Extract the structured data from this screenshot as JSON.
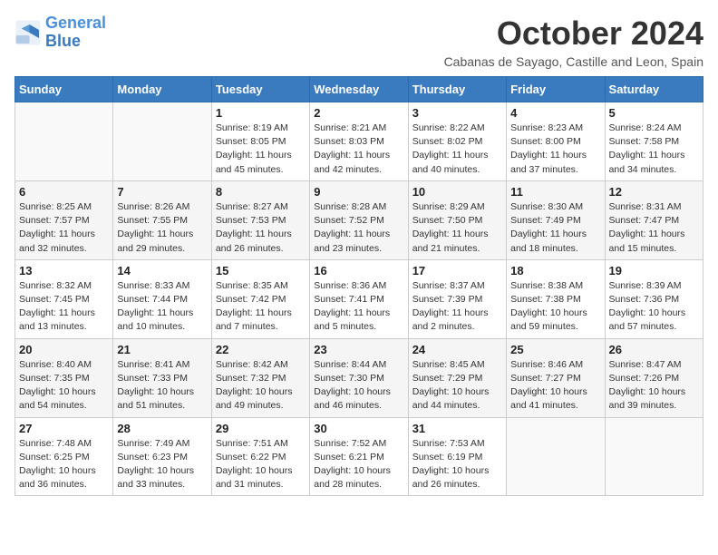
{
  "logo": {
    "line1": "General",
    "line2": "Blue"
  },
  "title": "October 2024",
  "subtitle": "Cabanas de Sayago, Castille and Leon, Spain",
  "days_of_week": [
    "Sunday",
    "Monday",
    "Tuesday",
    "Wednesday",
    "Thursday",
    "Friday",
    "Saturday"
  ],
  "weeks": [
    [
      {
        "num": "",
        "info": ""
      },
      {
        "num": "",
        "info": ""
      },
      {
        "num": "1",
        "info": "Sunrise: 8:19 AM\nSunset: 8:05 PM\nDaylight: 11 hours and 45 minutes."
      },
      {
        "num": "2",
        "info": "Sunrise: 8:21 AM\nSunset: 8:03 PM\nDaylight: 11 hours and 42 minutes."
      },
      {
        "num": "3",
        "info": "Sunrise: 8:22 AM\nSunset: 8:02 PM\nDaylight: 11 hours and 40 minutes."
      },
      {
        "num": "4",
        "info": "Sunrise: 8:23 AM\nSunset: 8:00 PM\nDaylight: 11 hours and 37 minutes."
      },
      {
        "num": "5",
        "info": "Sunrise: 8:24 AM\nSunset: 7:58 PM\nDaylight: 11 hours and 34 minutes."
      }
    ],
    [
      {
        "num": "6",
        "info": "Sunrise: 8:25 AM\nSunset: 7:57 PM\nDaylight: 11 hours and 32 minutes."
      },
      {
        "num": "7",
        "info": "Sunrise: 8:26 AM\nSunset: 7:55 PM\nDaylight: 11 hours and 29 minutes."
      },
      {
        "num": "8",
        "info": "Sunrise: 8:27 AM\nSunset: 7:53 PM\nDaylight: 11 hours and 26 minutes."
      },
      {
        "num": "9",
        "info": "Sunrise: 8:28 AM\nSunset: 7:52 PM\nDaylight: 11 hours and 23 minutes."
      },
      {
        "num": "10",
        "info": "Sunrise: 8:29 AM\nSunset: 7:50 PM\nDaylight: 11 hours and 21 minutes."
      },
      {
        "num": "11",
        "info": "Sunrise: 8:30 AM\nSunset: 7:49 PM\nDaylight: 11 hours and 18 minutes."
      },
      {
        "num": "12",
        "info": "Sunrise: 8:31 AM\nSunset: 7:47 PM\nDaylight: 11 hours and 15 minutes."
      }
    ],
    [
      {
        "num": "13",
        "info": "Sunrise: 8:32 AM\nSunset: 7:45 PM\nDaylight: 11 hours and 13 minutes."
      },
      {
        "num": "14",
        "info": "Sunrise: 8:33 AM\nSunset: 7:44 PM\nDaylight: 11 hours and 10 minutes."
      },
      {
        "num": "15",
        "info": "Sunrise: 8:35 AM\nSunset: 7:42 PM\nDaylight: 11 hours and 7 minutes."
      },
      {
        "num": "16",
        "info": "Sunrise: 8:36 AM\nSunset: 7:41 PM\nDaylight: 11 hours and 5 minutes."
      },
      {
        "num": "17",
        "info": "Sunrise: 8:37 AM\nSunset: 7:39 PM\nDaylight: 11 hours and 2 minutes."
      },
      {
        "num": "18",
        "info": "Sunrise: 8:38 AM\nSunset: 7:38 PM\nDaylight: 10 hours and 59 minutes."
      },
      {
        "num": "19",
        "info": "Sunrise: 8:39 AM\nSunset: 7:36 PM\nDaylight: 10 hours and 57 minutes."
      }
    ],
    [
      {
        "num": "20",
        "info": "Sunrise: 8:40 AM\nSunset: 7:35 PM\nDaylight: 10 hours and 54 minutes."
      },
      {
        "num": "21",
        "info": "Sunrise: 8:41 AM\nSunset: 7:33 PM\nDaylight: 10 hours and 51 minutes."
      },
      {
        "num": "22",
        "info": "Sunrise: 8:42 AM\nSunset: 7:32 PM\nDaylight: 10 hours and 49 minutes."
      },
      {
        "num": "23",
        "info": "Sunrise: 8:44 AM\nSunset: 7:30 PM\nDaylight: 10 hours and 46 minutes."
      },
      {
        "num": "24",
        "info": "Sunrise: 8:45 AM\nSunset: 7:29 PM\nDaylight: 10 hours and 44 minutes."
      },
      {
        "num": "25",
        "info": "Sunrise: 8:46 AM\nSunset: 7:27 PM\nDaylight: 10 hours and 41 minutes."
      },
      {
        "num": "26",
        "info": "Sunrise: 8:47 AM\nSunset: 7:26 PM\nDaylight: 10 hours and 39 minutes."
      }
    ],
    [
      {
        "num": "27",
        "info": "Sunrise: 7:48 AM\nSunset: 6:25 PM\nDaylight: 10 hours and 36 minutes."
      },
      {
        "num": "28",
        "info": "Sunrise: 7:49 AM\nSunset: 6:23 PM\nDaylight: 10 hours and 33 minutes."
      },
      {
        "num": "29",
        "info": "Sunrise: 7:51 AM\nSunset: 6:22 PM\nDaylight: 10 hours and 31 minutes."
      },
      {
        "num": "30",
        "info": "Sunrise: 7:52 AM\nSunset: 6:21 PM\nDaylight: 10 hours and 28 minutes."
      },
      {
        "num": "31",
        "info": "Sunrise: 7:53 AM\nSunset: 6:19 PM\nDaylight: 10 hours and 26 minutes."
      },
      {
        "num": "",
        "info": ""
      },
      {
        "num": "",
        "info": ""
      }
    ]
  ]
}
